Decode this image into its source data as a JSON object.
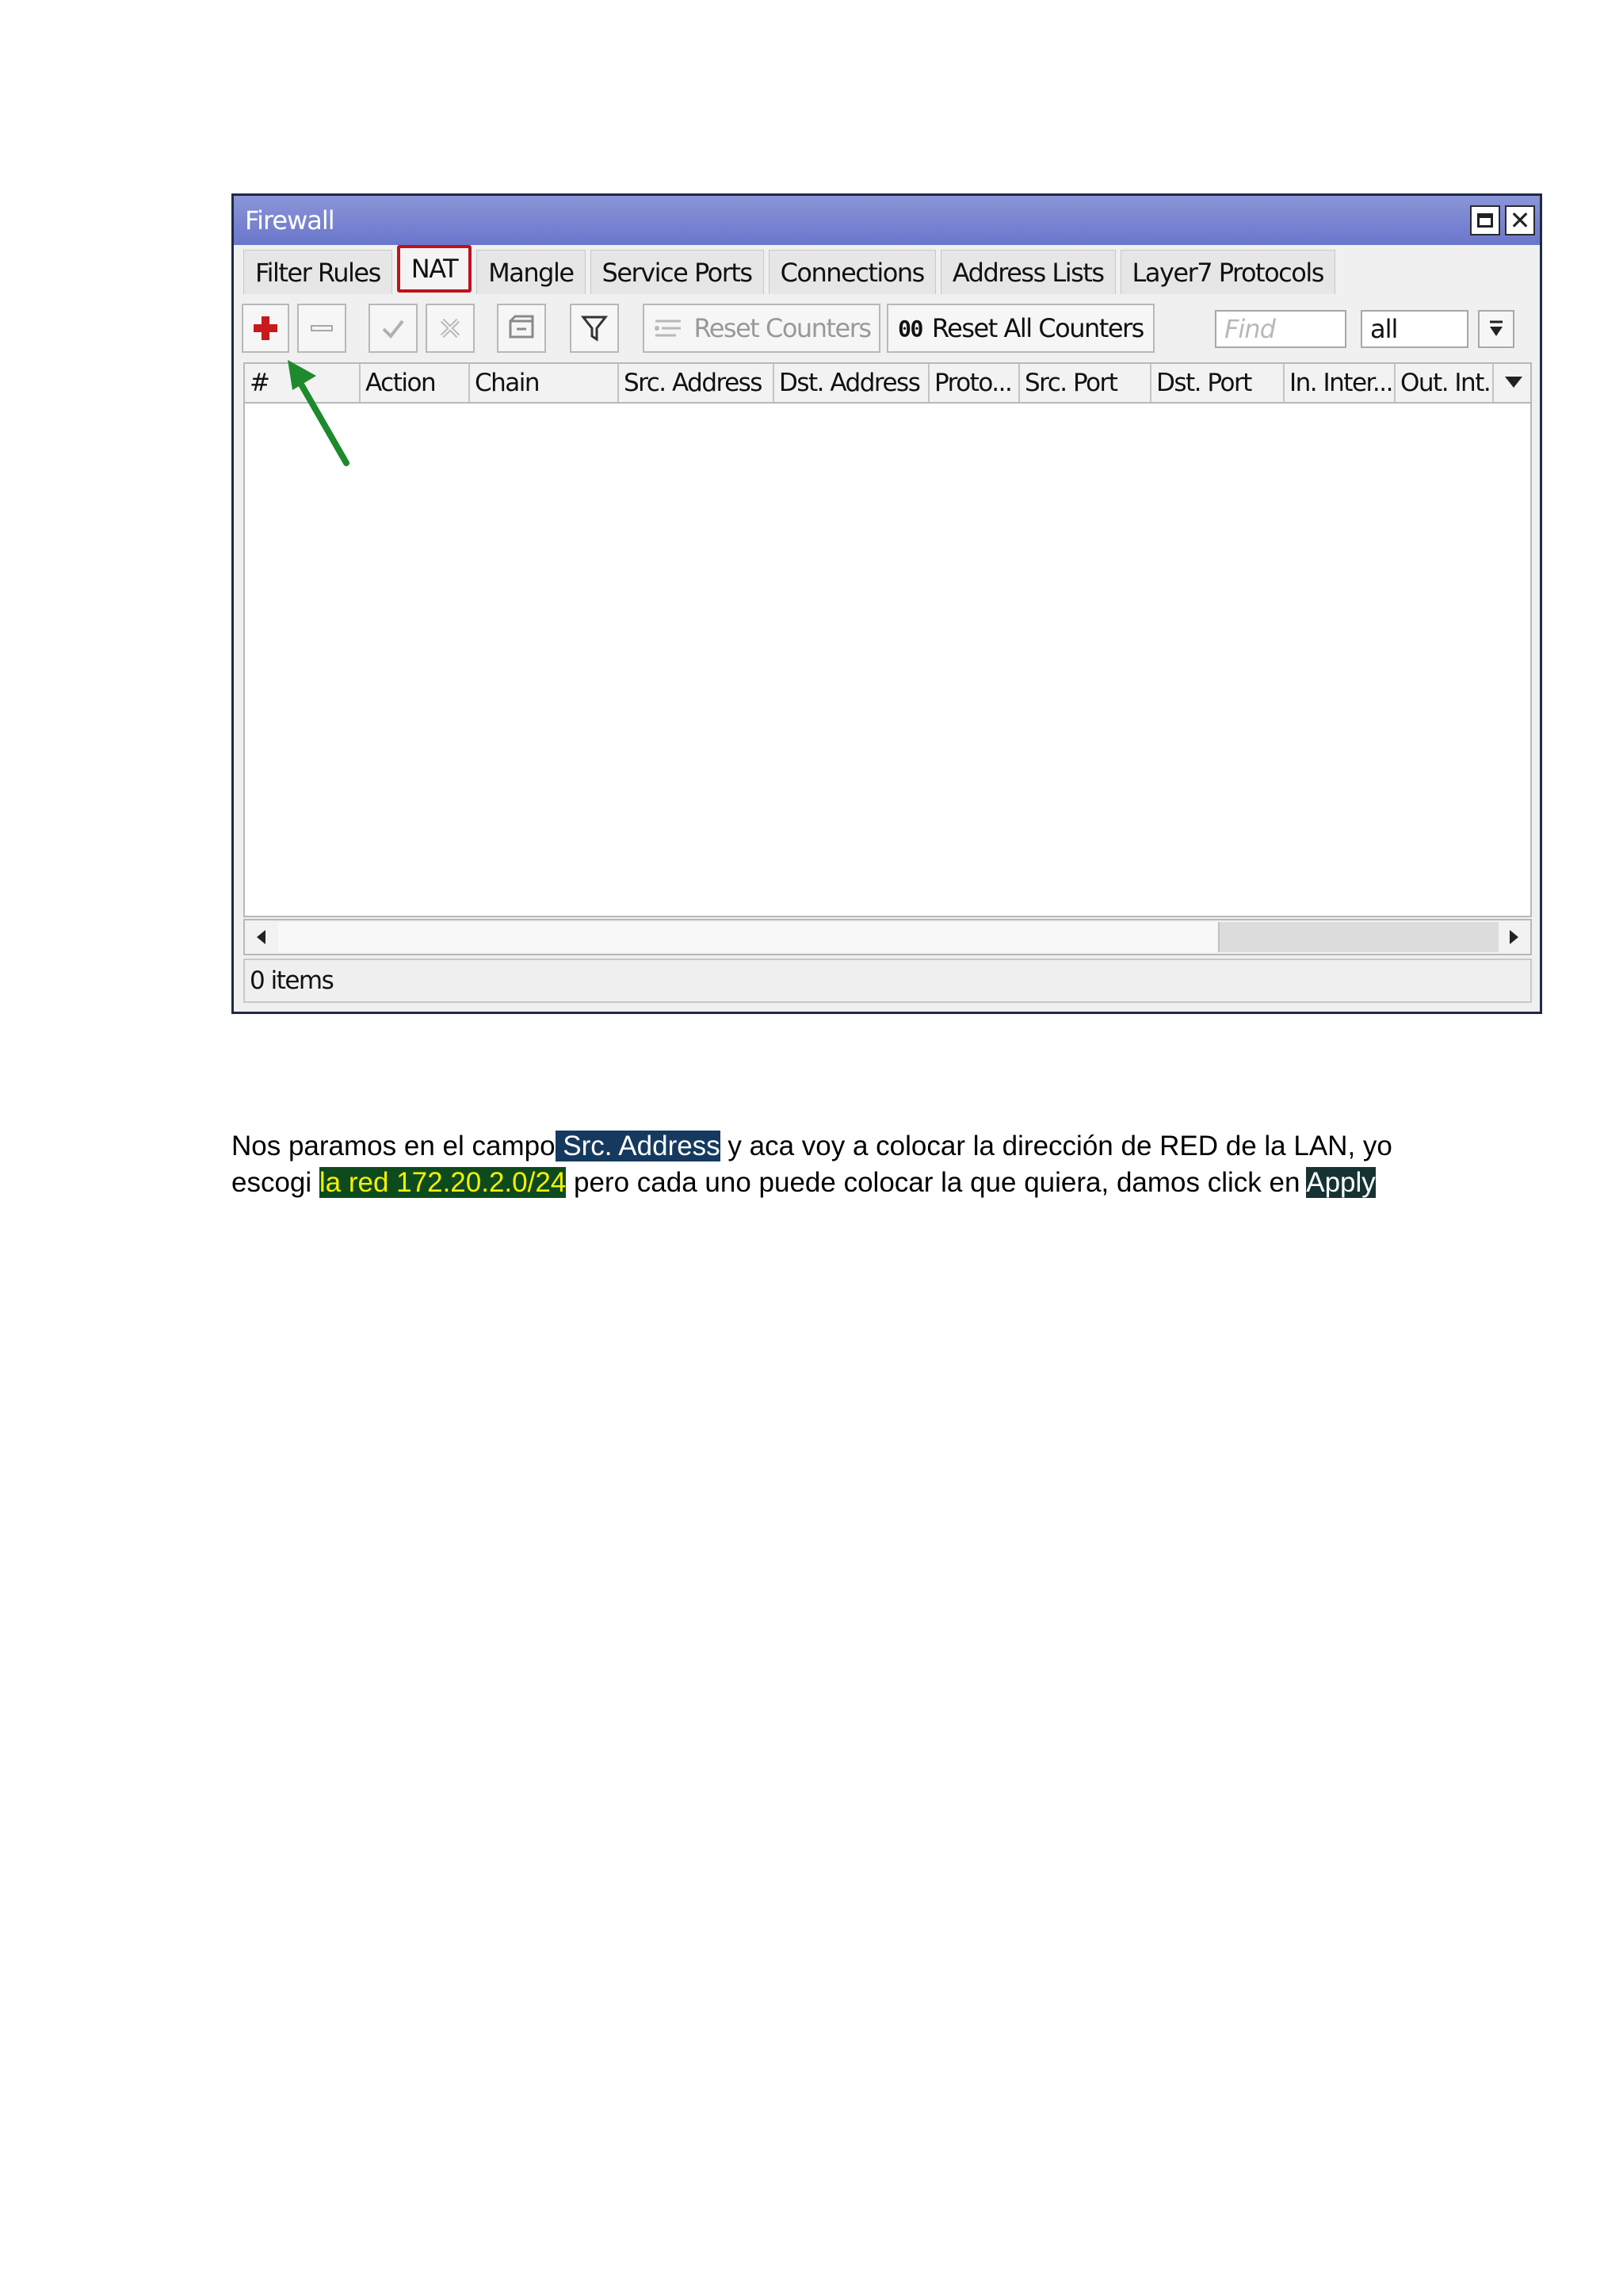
{
  "window": {
    "title": "Firewall",
    "tabs": [
      {
        "label": "Filter Rules",
        "active": false
      },
      {
        "label": "NAT",
        "active": true
      },
      {
        "label": "Mangle",
        "active": false
      },
      {
        "label": "Service Ports",
        "active": false
      },
      {
        "label": "Connections",
        "active": false
      },
      {
        "label": "Address Lists",
        "active": false
      },
      {
        "label": "Layer7 Protocols",
        "active": false
      }
    ],
    "toolbar": {
      "reset_counters": "Reset Counters",
      "reset_all_counters": "Reset All Counters",
      "reset_all_prefix": "00",
      "find_placeholder": "Find",
      "filter_value": "all"
    },
    "columns": [
      "#",
      "Action",
      "Chain",
      "Src. Address",
      "Dst. Address",
      "Proto...",
      "Src. Port",
      "Dst. Port",
      "In. Inter...",
      "Out. Int.."
    ],
    "status": "0 items",
    "highlight_color": "#c0121b",
    "arrow_color": "#1e8a2e"
  },
  "instructions": {
    "line1_before": "Nos paramos en el campo",
    "line1_highlight": " Src. Address",
    "line1_after": " y aca voy a colocar la  dirección de RED  de la LAN, yo",
    "line2_before": "escogi  ",
    "line2_highlight": "la red 172.20.2.0/24",
    "line2_middle": " pero cada uno puede colocar la que  quiera, damos click en ",
    "line2_highlight2": "Apply"
  }
}
